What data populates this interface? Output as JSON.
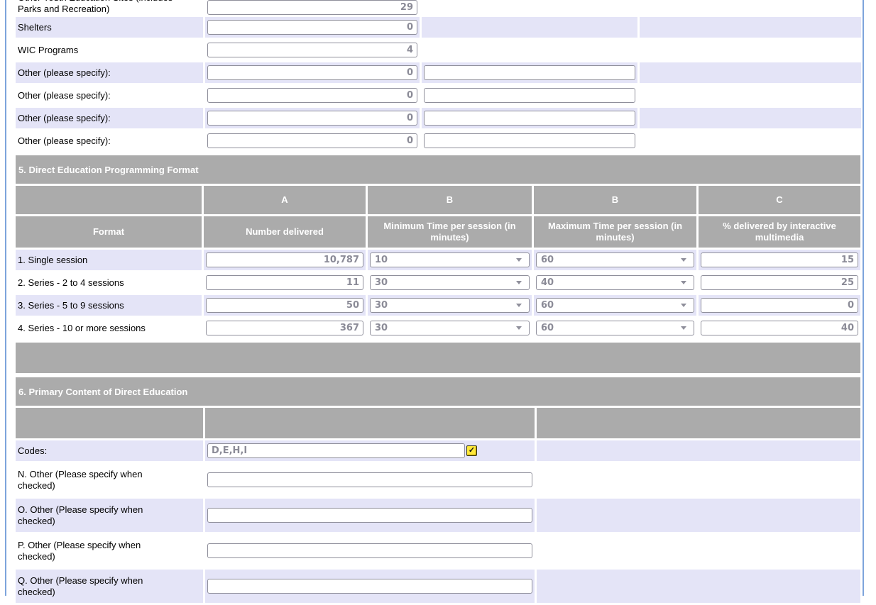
{
  "colors": {
    "header_gray": "#ababab",
    "row_lavender": "#e4e4f7",
    "page_border_blue": "#7da4dc",
    "input_text_gray": "#8b8b97"
  },
  "icons": {
    "check_icon": "✓"
  },
  "site_section": {
    "rows": [
      {
        "label": "Other Youth Education Sites (includes Parks and Recreation)",
        "count": "29"
      },
      {
        "label": "Shelters",
        "count": "0"
      },
      {
        "label": "WIC Programs",
        "count": "4"
      },
      {
        "label": "Other (please specify):",
        "count": "0",
        "specify": ""
      },
      {
        "label": "Other (please specify):",
        "count": "0",
        "specify": ""
      },
      {
        "label": "Other (please specify):",
        "count": "0",
        "specify": ""
      },
      {
        "label": "Other (please specify):",
        "count": "0",
        "specify": ""
      }
    ]
  },
  "section5": {
    "title": "5. Direct Education Programming Format",
    "letters": [
      "A",
      "B",
      "B",
      "C"
    ],
    "headers": {
      "format": "Format",
      "number": "Number delivered",
      "min": "Minimum Time per session (in minutes)",
      "max": "Maximum Time per session (in minutes)",
      "pct": "% delivered by interactive multimedia"
    },
    "rows": [
      {
        "format": "1. Single session",
        "number": "10,787",
        "min": "10",
        "max": "60",
        "pct": "15"
      },
      {
        "format": "2. Series - 2 to 4 sessions",
        "number": "11",
        "min": "30",
        "max": "40",
        "pct": "25"
      },
      {
        "format": "3. Series - 5 to 9 sessions",
        "number": "50",
        "min": "30",
        "max": "60",
        "pct": "0"
      },
      {
        "format": "4. Series - 10 or more sessions",
        "number": "367",
        "min": "30",
        "max": "60",
        "pct": "40"
      }
    ]
  },
  "section6": {
    "title": "6. Primary Content of Direct Education",
    "codes_label": "Codes:",
    "codes_value": "D,E,H,I",
    "rows": [
      {
        "label": "N. Other (Please specify when checked)",
        "value": ""
      },
      {
        "label": "O. Other (Please specify when checked)",
        "value": ""
      },
      {
        "label": "P. Other (Please specify when checked)",
        "value": ""
      },
      {
        "label": "Q. Other (Please specify when checked)",
        "value": ""
      }
    ]
  }
}
